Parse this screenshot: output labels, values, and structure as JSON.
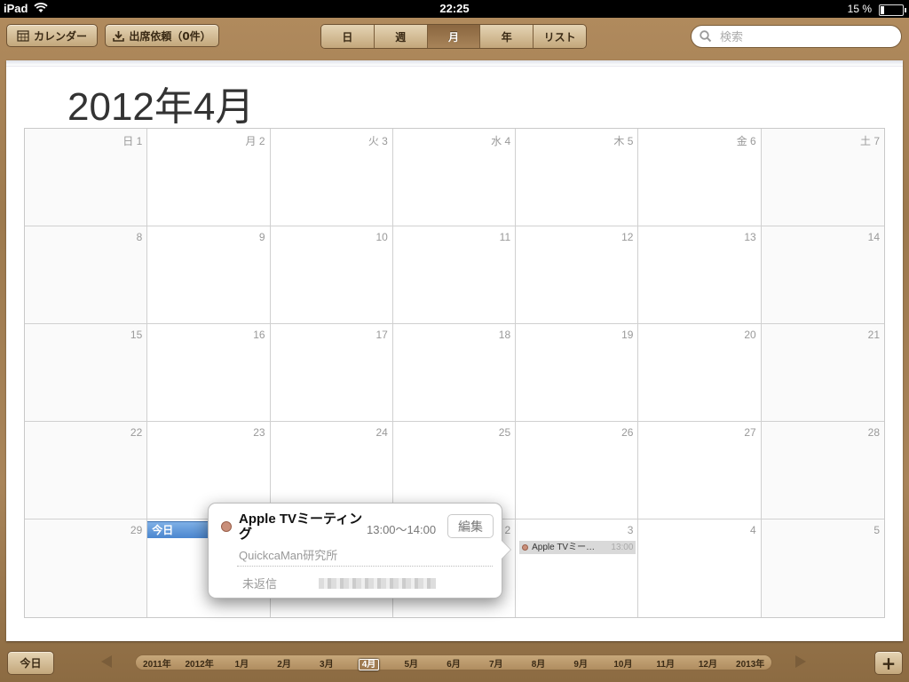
{
  "status_bar": {
    "carrier": "iPad",
    "time": "22:25",
    "battery": "15 %",
    "battery_level": 0.15
  },
  "toolbar": {
    "calendars_label": "カレンダー",
    "invitations_label": "出席依頼（0件）",
    "views": [
      {
        "label": "日",
        "active": false
      },
      {
        "label": "週",
        "active": false
      },
      {
        "label": "月",
        "active": true
      },
      {
        "label": "年",
        "active": false
      },
      {
        "label": "リスト",
        "active": false
      }
    ],
    "search_placeholder": "検索"
  },
  "month_title": "2012年4月",
  "weeks": [
    [
      "日 1",
      "月 2",
      "火 3",
      "水 4",
      "木 5",
      "金 6",
      "土 7"
    ],
    [
      "8",
      "9",
      "10",
      "11",
      "12",
      "13",
      "14"
    ],
    [
      "15",
      "16",
      "17",
      "18",
      "19",
      "20",
      "21"
    ],
    [
      "22",
      "23",
      "24",
      "25",
      "26",
      "27",
      "28"
    ],
    [
      "29",
      "",
      "",
      "2",
      "3",
      "4",
      "5"
    ]
  ],
  "today_label": "今日",
  "event_chip": {
    "title": "Apple TVミー…",
    "time": "13:00",
    "color": "#c98f7a"
  },
  "popover": {
    "title": "Apple TVミーティング",
    "time": "13:00～14:00",
    "edit_label": "編集",
    "location": "QuickcaMan研究所",
    "status_label": "未返信"
  },
  "bottom_bar": {
    "today_label": "今日",
    "add_label": "+",
    "timeline": [
      "2011年",
      "2012年",
      "1月",
      "2月",
      "3月",
      "4月",
      "5月",
      "6月",
      "7月",
      "8月",
      "9月",
      "10月",
      "11月",
      "12月",
      "2013年"
    ],
    "current_index": 5
  },
  "colors": {
    "accent": "#4a86cf",
    "leather": "#a9855a"
  }
}
